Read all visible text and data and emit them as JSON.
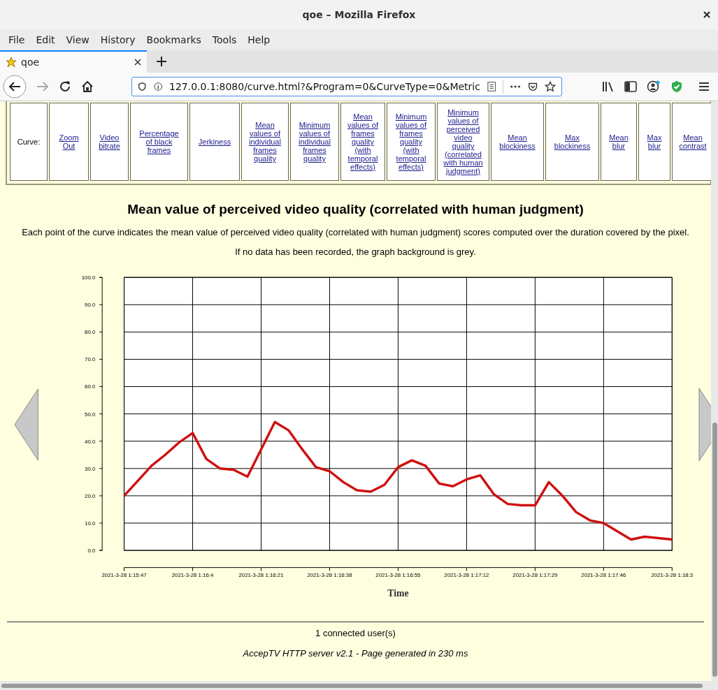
{
  "window": {
    "title": "qoe – Mozilla Firefox"
  },
  "menu": [
    "File",
    "Edit",
    "View",
    "History",
    "Bookmarks",
    "Tools",
    "Help"
  ],
  "tab": {
    "title": "qoe",
    "selected": true
  },
  "url": "127.0.0.1:8080/curve.html?&Program=0&CurveType=0&Metric",
  "curve_nav": {
    "label": "Curve:",
    "links": [
      "Zoom Out",
      "Video bitrate",
      "Percentage of black frames",
      "Jerkiness",
      "Mean values of individual frames quality",
      "Minimum values of individual frames quality",
      "Mean values of frames quality (with temporal effects)",
      "Minimum values of frames quality (with temporal effects)",
      "Minimum values of perceived video quality (correlated with human judgment)",
      "Mean blockiness",
      "Max blockiness",
      "Mean blur",
      "Max blur",
      "Mean contrast"
    ]
  },
  "title": "Mean value of perceived video quality (correlated with human judgment)",
  "description": [
    "Each point of the curve indicates the mean value of perceived video quality (correlated with human judgment) scores computed over the duration covered by the pixel.",
    "If no data has been recorded, the graph background is grey."
  ],
  "chart_data": {
    "type": "line",
    "grid": true,
    "xlabel": "Time",
    "ylim": [
      0,
      100
    ],
    "yticks": [
      {
        "value": 0,
        "label": "0.0"
      },
      {
        "value": 10,
        "label": "10.0"
      },
      {
        "value": 20,
        "label": "20.0"
      },
      {
        "value": 30,
        "label": "30.0"
      },
      {
        "value": 40,
        "label": "40.0"
      },
      {
        "value": 50,
        "label": "50.0"
      },
      {
        "value": 60,
        "label": "60.0"
      },
      {
        "value": 70,
        "label": "70.0"
      },
      {
        "value": 80,
        "label": "80.0"
      },
      {
        "value": 90,
        "label": "90.0"
      },
      {
        "value": 100,
        "label": "100.0"
      }
    ],
    "categories": [
      "2021-3-28 1:15:47",
      null,
      null,
      null,
      null,
      "2021-3-28 1:16:4",
      null,
      null,
      null,
      null,
      "2021-3-28 1:16:21",
      null,
      null,
      null,
      null,
      "2021-3-28 1:16:38",
      null,
      null,
      null,
      null,
      "2021-3-28 1:16:55",
      null,
      null,
      null,
      null,
      "2021-3-28 1:17:12",
      null,
      null,
      null,
      null,
      "2021-3-28 1:17:29",
      null,
      null,
      null,
      null,
      "2021-3-28 1:17:46",
      null,
      null,
      null,
      null,
      "2021-3-28 1:18:3"
    ],
    "series": [
      {
        "color": "#d01010",
        "values": [
          20,
          25.5,
          31,
          35,
          39.5,
          43,
          33.5,
          30,
          29.5,
          27,
          37,
          47,
          44,
          37,
          30.5,
          29,
          25,
          22,
          21.5,
          24,
          30.5,
          33,
          31,
          24.5,
          23.5,
          26,
          27.5,
          20.5,
          17,
          16.5,
          16.5,
          25,
          20,
          14,
          11,
          10,
          7,
          4,
          5,
          4.5,
          4
        ]
      }
    ]
  },
  "footer": {
    "users": "1 connected user(s)",
    "server": "AccepTV HTTP server v2.1 - Page generated in 230 ms"
  }
}
